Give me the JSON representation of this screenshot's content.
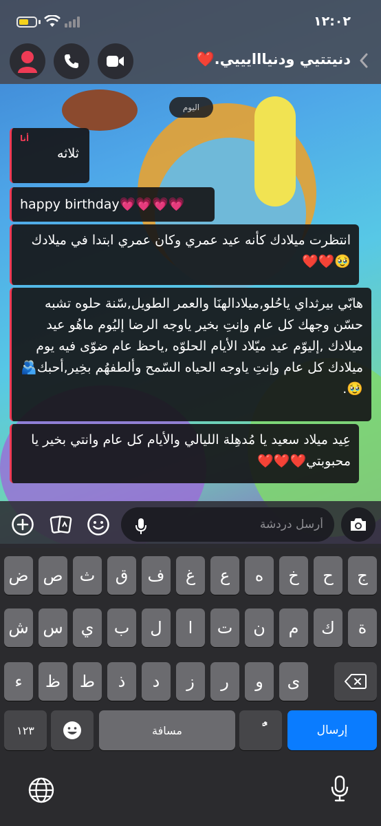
{
  "status_bar": {
    "time": "١٢:٠٢",
    "battery_level": 0.6,
    "battery_color": "#f5d21b"
  },
  "header": {
    "title": "دنيتتيي ودنيااايييي.❤️"
  },
  "chat": {
    "date_label": "اليوم",
    "messages": [
      {
        "sender": "أنا",
        "text": "ثلاثه"
      },
      {
        "text": "happy birthday💗💗💗💗"
      },
      {
        "text": "انتظرت ميلادك كأنه عيد عمري  وكان عمري ابتدا في ميلادك🥹❤️❤️"
      },
      {
        "text": "هابّي بيرثداي ياحُلو,ميلادالهنَا والعمر الطويل,سّنة حلوه تشبه حسّن وجهك كل عام وإنتِ بخير ياوجه الرضا إليُوم ماهُو عيد ميلادك ,إليوّم عيد ميّلاد الأيام الحلوّه ,ياحظ عام ضوّى فيه يوم ميلادك كل عام وإنتِ ياوجه الحياه السّمح وألطفهُم بخِير,أحبك🫂🥹."
      },
      {
        "text": "عِيد ميلاد سعيد يا مُدهِلة الليالي والأيام  كل عام وانتي بخير يا محبوبتي❤️❤️❤️"
      }
    ]
  },
  "composer": {
    "placeholder": "أرسل دردشة"
  },
  "keyboard": {
    "row1": [
      "ض",
      "ص",
      "ث",
      "ق",
      "ف",
      "غ",
      "ع",
      "ه",
      "خ",
      "ح",
      "ج"
    ],
    "row2": [
      "ش",
      "س",
      "ي",
      "ب",
      "ل",
      "ا",
      "ت",
      "ن",
      "م",
      "ك",
      "ة"
    ],
    "row3": [
      "ء",
      "ظ",
      "ط",
      "ذ",
      "د",
      "ز",
      "ر",
      "و",
      "ى"
    ],
    "numbers_key": "١٢٣",
    "space_label": "مسافة",
    "tanween_key": "ًٌ",
    "send_label": "إرسال"
  },
  "colors": {
    "accent_red": "#ee3b55",
    "send_blue": "#0a7cff",
    "battery_yellow": "#f5d21b"
  }
}
